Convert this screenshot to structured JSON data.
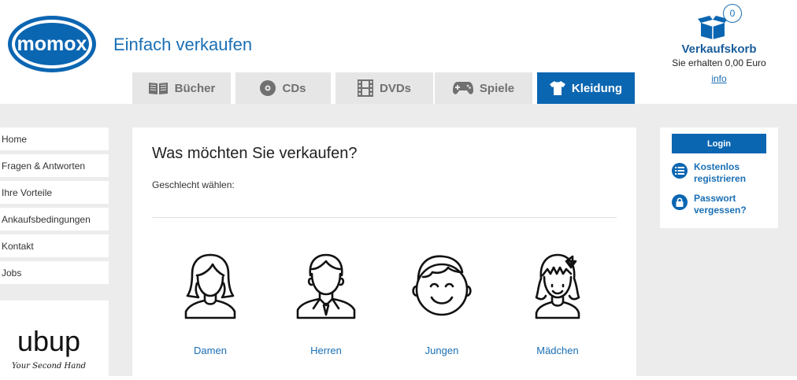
{
  "header": {
    "logo_text": "momox",
    "tagline": "Einfach verkaufen"
  },
  "tabs": [
    {
      "label": "Bücher",
      "icon": "book-icon",
      "active": false
    },
    {
      "label": "CDs",
      "icon": "cd-icon",
      "active": false
    },
    {
      "label": "DVDs",
      "icon": "film-icon",
      "active": false
    },
    {
      "label": "Spiele",
      "icon": "gamepad-icon",
      "active": false
    },
    {
      "label": "Kleidung",
      "icon": "shirt-icon",
      "active": true
    }
  ],
  "cart": {
    "count": "0",
    "title": "Verkaufskorb",
    "subtitle": "Sie erhalten 0,00 Euro",
    "info_link": "info"
  },
  "sidebar": {
    "items": [
      "Home",
      "Fragen & Antworten",
      "Ihre Vorteile",
      "Ankaufsbedingungen",
      "Kontakt",
      "Jobs"
    ],
    "partner_logo": "ubup",
    "partner_tagline": "Your Second Hand"
  },
  "main": {
    "title": "Was möchten Sie verkaufen?",
    "subtitle": "Geschlecht wählen:",
    "categories": [
      {
        "label": "Damen",
        "icon": "woman-icon"
      },
      {
        "label": "Herren",
        "icon": "man-icon"
      },
      {
        "label": "Jungen",
        "icon": "boy-icon"
      },
      {
        "label": "Mädchen",
        "icon": "girl-icon"
      }
    ]
  },
  "login": {
    "button": "Login",
    "register": "Kostenlos registrieren",
    "forgot": "Passwort vergessen?"
  },
  "colors": {
    "primary": "#0b66b2",
    "link": "#1a6fb5",
    "tab_inactive": "#e6e6e6",
    "page_bg": "#ececec"
  }
}
